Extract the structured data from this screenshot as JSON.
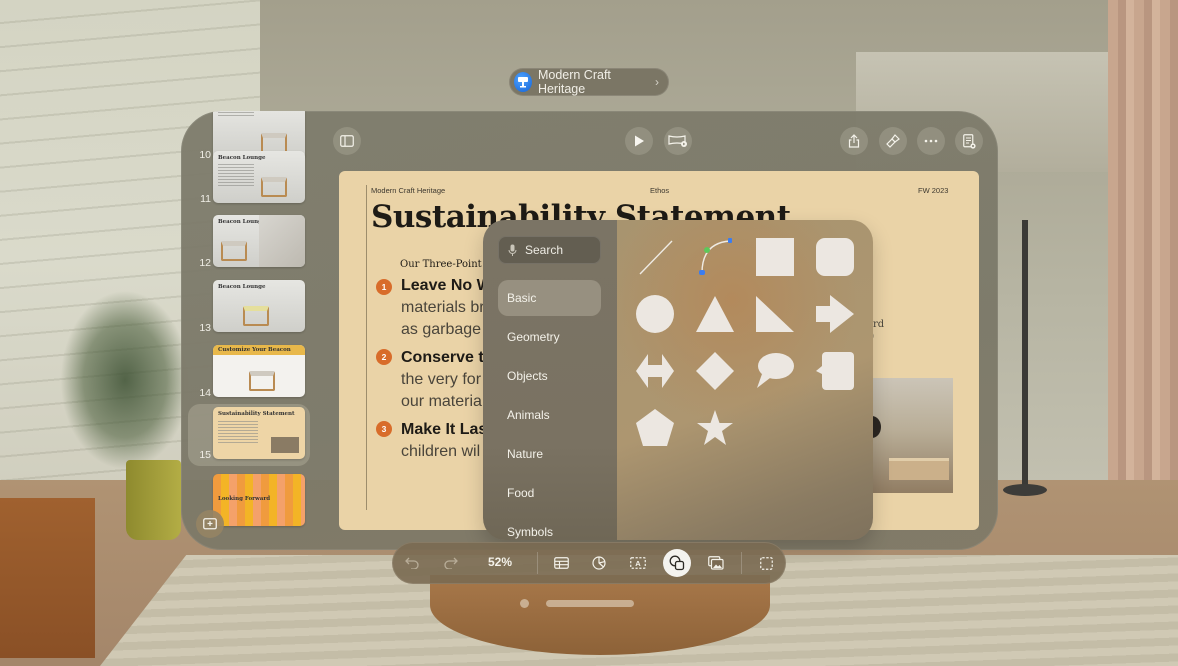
{
  "document": {
    "title": "Modern Craft Heritage",
    "app_icon": "keynote-podium-icon"
  },
  "sidebar": {
    "slides": [
      {
        "number": "10",
        "title": "",
        "selected": false
      },
      {
        "number": "11",
        "title": "Beacon Lounge",
        "selected": false
      },
      {
        "number": "12",
        "title": "Beacon Lounge",
        "selected": false
      },
      {
        "number": "13",
        "title": "Beacon Lounge",
        "selected": false
      },
      {
        "number": "14",
        "title": "Customize Your Beacon",
        "selected": false
      },
      {
        "number": "15",
        "title": "Sustainability Statement",
        "selected": true
      },
      {
        "number": "",
        "title": "Looking Forward",
        "selected": false
      }
    ],
    "add_slide_icon": "add-slide-icon"
  },
  "top_toolbar": {
    "left": [
      "sidebar-toggle-icon"
    ],
    "center": [
      "play-icon",
      "live-video-icon"
    ],
    "right": [
      "share-icon",
      "format-brush-icon",
      "more-icon",
      "presenter-notes-icon"
    ]
  },
  "slide": {
    "header_left": "Modern Craft Heritage",
    "header_center": "Ethos",
    "header_right": "FW 2023",
    "title": "Sustainability Statement",
    "subtitle": "Our Three-Point P",
    "points": [
      {
        "number": "1",
        "title": "Leave No W",
        "body": [
          "materials br",
          "as garbage"
        ]
      },
      {
        "number": "2",
        "title": "Conserve t",
        "body": [
          "the very for",
          "our materia"
        ]
      },
      {
        "number": "3",
        "title": "Make It Las",
        "body": [
          "children wil"
        ]
      }
    ],
    "side_text": [
      "ard",
      "l)"
    ],
    "accent_color": "#d86c2a",
    "background_color": "#ead3a7"
  },
  "shape_picker": {
    "search_placeholder": "Search",
    "categories": [
      {
        "label": "Basic",
        "active": true
      },
      {
        "label": "Geometry",
        "active": false
      },
      {
        "label": "Objects",
        "active": false
      },
      {
        "label": "Animals",
        "active": false
      },
      {
        "label": "Nature",
        "active": false
      },
      {
        "label": "Food",
        "active": false
      },
      {
        "label": "Symbols",
        "active": false
      }
    ],
    "shapes": [
      "line",
      "curve",
      "square",
      "rounded-square",
      "circle",
      "triangle",
      "right-triangle",
      "arrow",
      "double-arrow",
      "diamond",
      "speech-bubble",
      "callout",
      "pentagon",
      "star"
    ]
  },
  "bottom_toolbar": {
    "zoom": "52%",
    "tools": [
      "undo",
      "redo",
      "table",
      "chart",
      "text-box",
      "shape",
      "media",
      "select"
    ],
    "active_tool": "shape"
  }
}
